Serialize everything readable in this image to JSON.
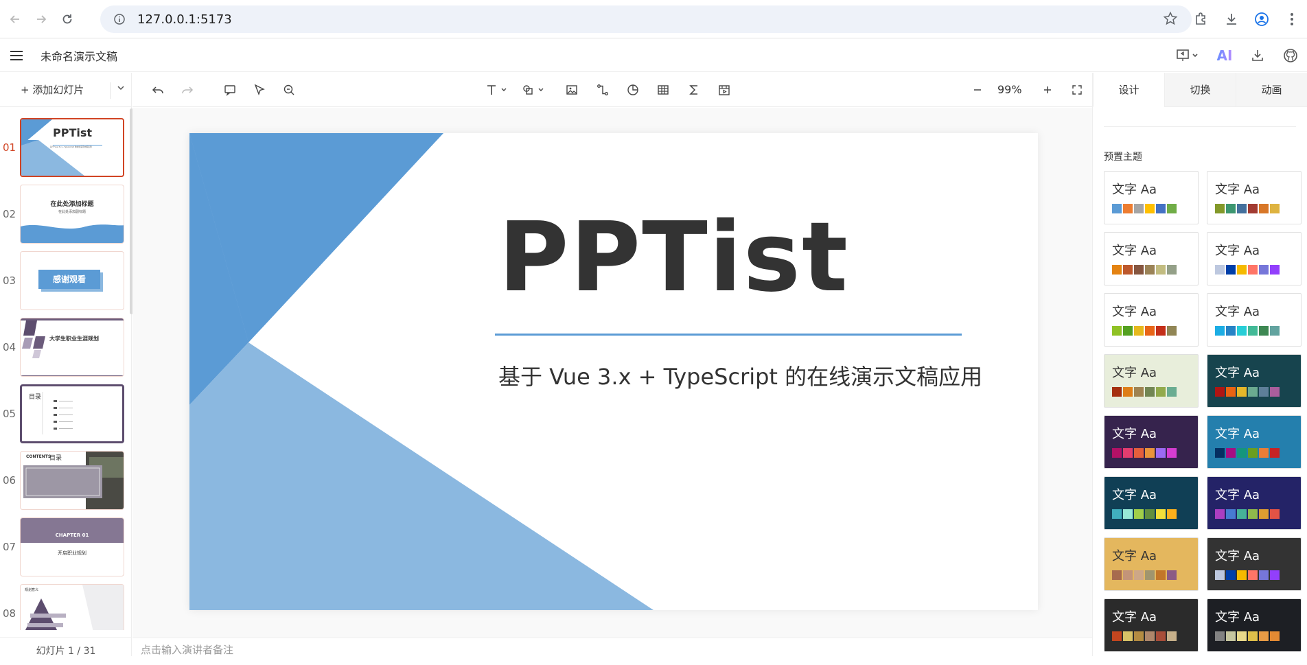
{
  "browser": {
    "url": "127.0.0.1:5173"
  },
  "header": {
    "title": "未命名演示文稿",
    "ai_label": "AI"
  },
  "left_panel": {
    "add_slide_label": "+ 添加幻灯片",
    "slide_count": "幻灯片 1 / 31",
    "thumbnails": [
      {
        "num": "01",
        "title": "PPTist",
        "subtitle": "基于 Vue 3.x + TypeScript 的在线演示文稿应用"
      },
      {
        "num": "02",
        "title": "在此处添加标题",
        "subtitle": "在此处添加副标题"
      },
      {
        "num": "03",
        "title": "感谢观看"
      },
      {
        "num": "04",
        "title": "大学生职业生涯规划"
      },
      {
        "num": "05",
        "title": "目录"
      },
      {
        "num": "06",
        "title": "目录",
        "prefix": "CONTENTS"
      },
      {
        "num": "07",
        "title": "CHAPTER 01",
        "subtitle": "开启职业规划"
      },
      {
        "num": "08",
        "title": "规划意义"
      }
    ]
  },
  "toolbar": {
    "zoom": "99%"
  },
  "slide": {
    "title": "PPTist",
    "subtitle": "基于 Vue 3.x + TypeScript 的在线演示文稿应用",
    "colors": {
      "dark_blue": "#5b9bd5",
      "light_blue": "#8bb8e0"
    }
  },
  "notes": {
    "placeholder": "点击输入演讲者备注"
  },
  "right_panel": {
    "tabs": [
      "设计",
      "切换",
      "动画"
    ],
    "section": "预置主题",
    "theme_text": "文字 Aa",
    "themes": [
      {
        "bg": "#ffffff",
        "fg": "#333333",
        "colors": [
          "#5b9bd5",
          "#ed7d31",
          "#a5a5a5",
          "#ffc000",
          "#4472c4",
          "#70ad47"
        ]
      },
      {
        "bg": "#ffffff",
        "fg": "#333333",
        "colors": [
          "#83992a",
          "#3c9670",
          "#44709d",
          "#a23b32",
          "#d87728",
          "#deb340"
        ]
      },
      {
        "bg": "#ffffff",
        "fg": "#333333",
        "colors": [
          "#e48312",
          "#bd582c",
          "#865640",
          "#9b8357",
          "#c2bc80",
          "#94a088"
        ]
      },
      {
        "bg": "#ffffff",
        "fg": "#333333",
        "colors": [
          "#bdc8df",
          "#003fa9",
          "#f5ba00",
          "#ff7567",
          "#7676d9",
          "#923ffc"
        ]
      },
      {
        "bg": "#ffffff",
        "fg": "#333333",
        "colors": [
          "#90c225",
          "#54a121",
          "#e6b91e",
          "#e86618",
          "#c42f19",
          "#918655"
        ]
      },
      {
        "bg": "#ffffff",
        "fg": "#333333",
        "colors": [
          "#1cade4",
          "#2683c6",
          "#27ced7",
          "#42ba97",
          "#3e8853",
          "#62a39f"
        ]
      },
      {
        "bg": "#e8eedb",
        "fg": "#333333",
        "colors": [
          "#a5300f",
          "#de7e18",
          "#9f8351",
          "#728653",
          "#92aa4c",
          "#6aac91"
        ]
      },
      {
        "bg": "#17444e",
        "fg": "#ffffff",
        "colors": [
          "#b01513",
          "#ea6312",
          "#e6b729",
          "#6bab90",
          "#5e7f99",
          "#aa5e9d"
        ]
      },
      {
        "bg": "#36234d",
        "fg": "#ffffff",
        "colors": [
          "#b31166",
          "#e33d6f",
          "#e45f3c",
          "#e9943a",
          "#9b6bf2",
          "#d53dd0"
        ]
      },
      {
        "bg": "#247fad",
        "fg": "#ffffff",
        "colors": [
          "#052f61",
          "#a50e82",
          "#14967c",
          "#6a9e1f",
          "#e87d37",
          "#c62324"
        ]
      },
      {
        "bg": "#103f55",
        "fg": "#ffffff",
        "colors": [
          "#40aebd",
          "#97e8d5",
          "#a1cf49",
          "#628f3e",
          "#f2df3a",
          "#fcb01c"
        ]
      },
      {
        "bg": "#242367",
        "fg": "#ffffff",
        "colors": [
          "#ac3ec1",
          "#477bd1",
          "#46b298",
          "#90ba4c",
          "#dd9d31",
          "#e25345"
        ]
      },
      {
        "bg": "#e4b75e",
        "fg": "#333333",
        "colors": [
          "#a76b4e",
          "#c39479",
          "#cda787",
          "#a0956e",
          "#c27629",
          "#8b5b85"
        ]
      },
      {
        "bg": "#333333",
        "fg": "#ffffff",
        "colors": [
          "#bdc8df",
          "#003fa9",
          "#f5ba00",
          "#ff7567",
          "#7676d9",
          "#923ffc"
        ]
      },
      {
        "bg": "#2b2b2b",
        "fg": "#ffffff",
        "colors": [
          "#c3461f",
          "#d8c367",
          "#b48c42",
          "#af876b",
          "#a84d39",
          "#c7b08a"
        ]
      },
      {
        "bg": "#1d1f24",
        "fg": "#ffffff",
        "colors": [
          "#828282",
          "#c6c69f",
          "#e9d98a",
          "#dfbf4a",
          "#e89b45",
          "#e48a33"
        ]
      }
    ]
  }
}
